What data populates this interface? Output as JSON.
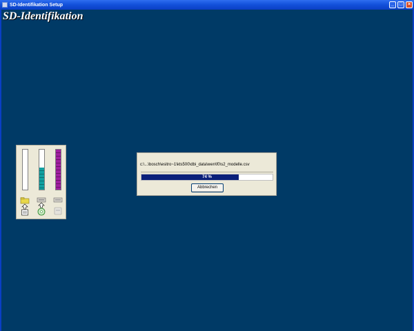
{
  "window": {
    "title": "SD-Identifikation Setup",
    "minimize_symbol": "_",
    "maximize_symbol": "□",
    "close_symbol": "×"
  },
  "banner": {
    "title": "SD-Identifikation"
  },
  "resource_meter": {
    "meters": [
      {
        "name": "disk-meter",
        "level_fraction": 0.0,
        "color": "#ffffff",
        "icon": "folder-upload-icon"
      },
      {
        "name": "cpu-meter",
        "level_fraction": 0.55,
        "color": "#12a1a1",
        "icon": "cd-install-icon"
      },
      {
        "name": "memory-meter",
        "level_fraction": 1.0,
        "color": "#a020a0",
        "icon": "drive-icon"
      }
    ]
  },
  "progress_dialog": {
    "current_file": "c:\\...\\bosch\\esitro~1\\kts500\\dbi_data\\wen\\f0\\s2_modelle.csv",
    "progress_percent": 74,
    "progress_label": "74 %",
    "progress_color": "#0a1f7a",
    "cancel_label": "Abbrechen"
  },
  "colors": {
    "desktop_background": "#003a66",
    "titlebar": "#1452dc",
    "dialog_face": "#ece9d8"
  }
}
